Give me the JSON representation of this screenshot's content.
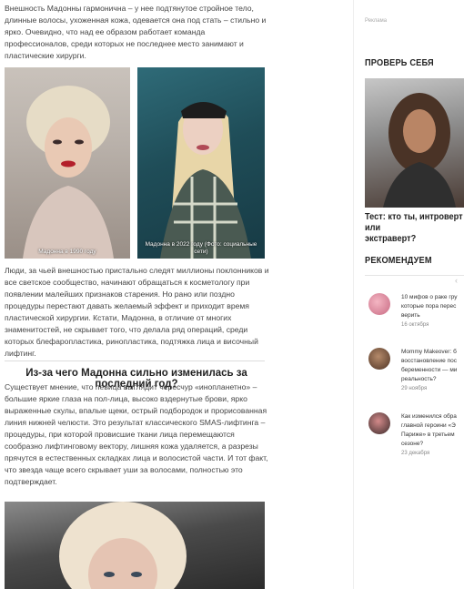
{
  "article": {
    "p1": "Внешность Мадонны гармонична – у нее подтянутое стройное тело, длинные волосы, ухоженная кожа, одевается она под стать – стильно и ярко. Очевидно, что над ее образом работает команда профессионалов, среди которых не последнее место занимают и пластические хирурги.",
    "photo1_caption": "Мадонна в 1990 году",
    "photo2_caption": "Мадонна в 2022 году (Фото: социальные сети)",
    "p2": "Люди, за чьей внешностью пристально следят миллионы поклонников и все светское сообщество, начинают обращаться к косметологу при появлении малейших признаков старения. Но рано или поздно процедуры перестают давать желаемый эффект и приходит время пластической хирургии. Кстати, Мадонна, в отличие от многих знаменитостей, не скрывает того, что делала ряд операций, среди которых блефаропластика, ринопластика, подтяжка лица и височный лифтинг.",
    "section_title": "Из-за чего Мадонна сильно изменилась за последний год?",
    "p3": "Существует мнение, что певица выглядит чересчур «инопланетно» – большие яркие глаза на пол-лица, высоко вздернутые брови, ярко выраженные скулы, впалые щеки, острый подбородок и прорисованная линия нижней челюсти. Это результат классического SMAS-лифтинга – процедуры, при которой провисшие ткани лица перемещаются сообразно лифтинговому вектору, лишняя кожа удаляется, а разрезы прячутся в естественных складках лица и волосистой части. И тот факт, что звезда чаще всего скрывает уши за волосами, полностью это подтверждает."
  },
  "sidebar": {
    "ad_label": "Реклама",
    "check_heading": "ПРОВЕРЬ СЕБЯ",
    "quiz_title": "Тест: кто ты, интроверт или\nэкстраверт?",
    "recommend_heading": "РЕКОМЕНДУЕМ",
    "arrow": "‹",
    "items": [
      {
        "text": "10 мифов о раке гру\nкоторые пора перес\nверить",
        "date": "16 октября"
      },
      {
        "text": "Mommy Makeover: б\nвосстановление пос\nбеременности — ми\nреальность?",
        "date": "29 ноября"
      },
      {
        "text": "Как изменился обра\nглавной героини «Э\nПариже» в третьем\nсезоне?",
        "date": "23 декабря"
      }
    ]
  }
}
